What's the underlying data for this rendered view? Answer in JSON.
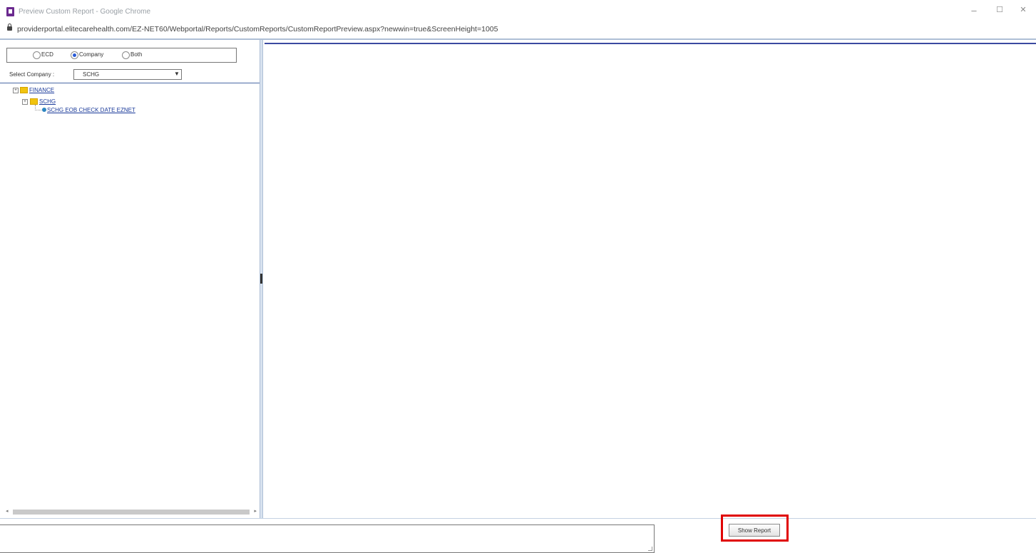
{
  "window": {
    "title": "Preview Custom Report - Google Chrome",
    "controls": {
      "minimize": "–",
      "maximize": "☐",
      "close": "✕"
    }
  },
  "address": {
    "url": "providerportal.elitecarehealth.com/EZ-NET60/Webportal/Reports/CustomReports/CustomReportPreview.aspx?newwin=true&ScreenHeight=1005"
  },
  "filter": {
    "options": [
      {
        "label": "ECD",
        "checked": false
      },
      {
        "label": "Company",
        "checked": true
      },
      {
        "label": "Both",
        "checked": false
      }
    ],
    "select_label": "Select Company :",
    "select_value": "SCHG"
  },
  "tree": {
    "root": "FINANCE",
    "child": "SCHG",
    "report": "SCHG EOB CHECK DATE EZNET",
    "expand_symbol": "+"
  },
  "footer": {
    "show_report_label": "Show Report"
  },
  "colors": {
    "accent_border": "#3b4aa0",
    "highlight": "#e00000",
    "link": "#1a3a9a"
  },
  "icons": [
    "lock-icon",
    "folder-icon",
    "report-icon",
    "resize-grip-icon",
    "splitter-handle-icon"
  ]
}
